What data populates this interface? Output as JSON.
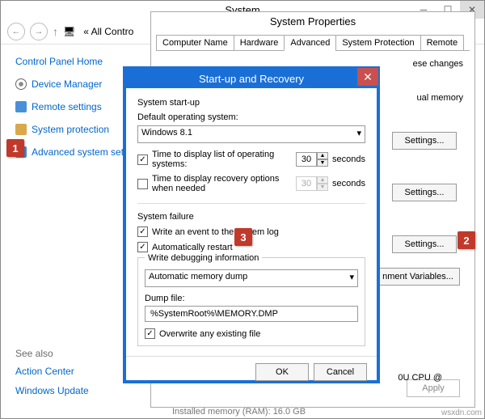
{
  "cp": {
    "title": "System",
    "breadcrumb": "« All Contro",
    "home": "Control Panel Home",
    "links": [
      {
        "label": "Device Manager"
      },
      {
        "label": "Remote settings"
      },
      {
        "label": "System protection"
      },
      {
        "label": "Advanced system setti"
      }
    ],
    "seealso_title": "See also",
    "seealso": [
      {
        "label": "Action Center"
      },
      {
        "label": "Windows Update"
      }
    ],
    "installed_mem": "Installed memory (RAM):    16.0 GB"
  },
  "sysprop": {
    "title": "System Properties",
    "tabs": [
      "Computer Name",
      "Hardware",
      "Advanced",
      "System Protection",
      "Remote"
    ],
    "active_tab": "Advanced",
    "note": "ese changes",
    "section_vm": "ual memory",
    "btn_settings": "Settings...",
    "btn_env": "nment Variables...",
    "btn_apply": "Apply",
    "cpu_tail": "0U CPU @"
  },
  "startup": {
    "title": "Start-up and Recovery",
    "group_startup": "System start-up",
    "label_default_os": "Default operating system:",
    "os_value": "Windows 8.1",
    "chk_list_label": "Time to display list of operating systems:",
    "chk_list_seconds": "30",
    "chk_recovery_label": "Time to display recovery options when needed",
    "chk_recovery_seconds": "30",
    "seconds": "seconds",
    "group_failure": "System failure",
    "chk_log": "Write an event to the system log",
    "chk_restart": "Automatically restart",
    "group_debug": "Write debugging information",
    "dump_type": "Automatic memory dump",
    "label_dumpfile": "Dump file:",
    "dumpfile": "%SystemRoot%\\MEMORY.DMP",
    "chk_overwrite": "Overwrite any existing file",
    "btn_ok": "OK",
    "btn_cancel": "Cancel"
  },
  "badges": {
    "one": "1",
    "two": "2",
    "three": "3"
  },
  "watermark": "wsxdn.com"
}
